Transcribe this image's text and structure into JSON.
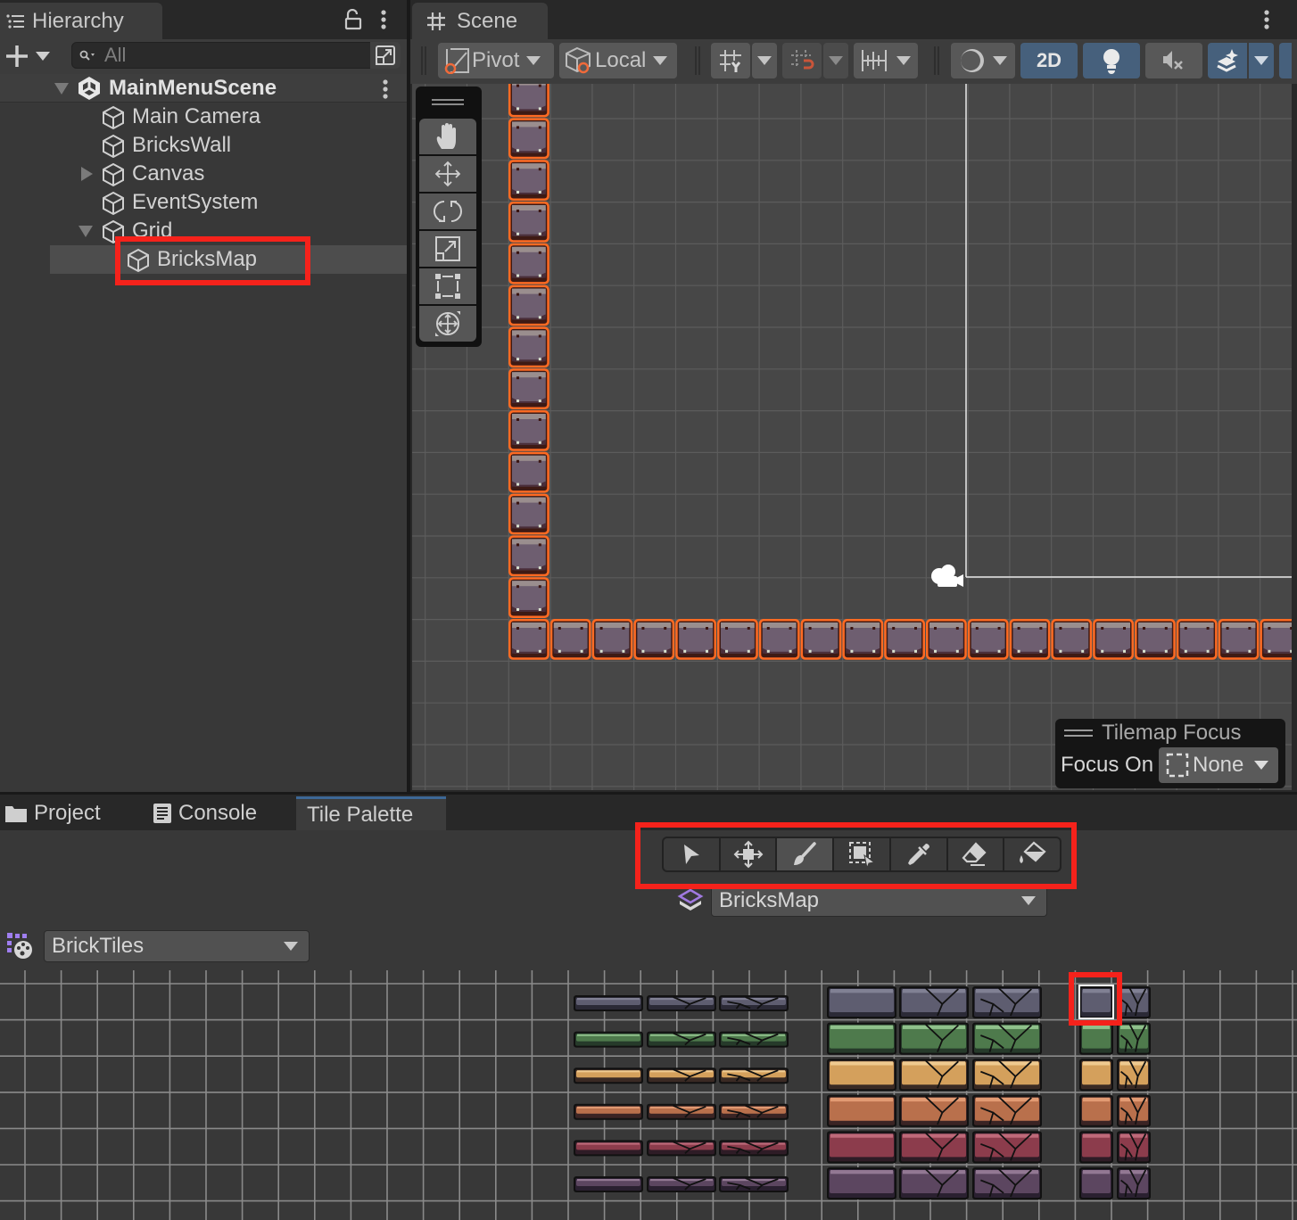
{
  "hierarchy": {
    "tab_label": "Hierarchy",
    "search_placeholder": "All",
    "scene": "MainMenuScene",
    "items": [
      {
        "label": "Main Camera",
        "depth": 1,
        "foldout": "none"
      },
      {
        "label": "BricksWall",
        "depth": 1,
        "foldout": "none"
      },
      {
        "label": "Canvas",
        "depth": 1,
        "foldout": "collapsed"
      },
      {
        "label": "EventSystem",
        "depth": 1,
        "foldout": "none"
      },
      {
        "label": "Grid",
        "depth": 1,
        "foldout": "expanded"
      },
      {
        "label": "BricksMap",
        "depth": 2,
        "foldout": "none",
        "selected": true
      }
    ]
  },
  "scene": {
    "tab_label": "Scene",
    "toolbar": {
      "pivot_label": "Pivot",
      "space_label": "Local",
      "mode_2d_label": "2D",
      "mode_2d_active": true,
      "lighting_active": true,
      "audio_active": false,
      "effects_active": true
    },
    "tools": [
      "hand",
      "move",
      "rotate",
      "scale",
      "rect",
      "transform"
    ],
    "tilemap_focus": {
      "title": "Tilemap Focus",
      "label": "Focus On",
      "value": "None"
    },
    "bricks": {
      "vertical_column_count": 13,
      "bottom_row_count": 19
    }
  },
  "bottom": {
    "tabs": [
      {
        "label": "Project",
        "icon": "folder-icon",
        "active": false
      },
      {
        "label": "Console",
        "icon": "console-icon",
        "active": false
      },
      {
        "label": "Tile Palette",
        "icon": "",
        "active": true
      }
    ],
    "palette_tools": [
      {
        "name": "select",
        "active": false
      },
      {
        "name": "move",
        "active": false
      },
      {
        "name": "paint",
        "active": true
      },
      {
        "name": "box-fill",
        "active": false
      },
      {
        "name": "picker",
        "active": false
      },
      {
        "name": "erase",
        "active": false
      },
      {
        "name": "flood-fill",
        "active": false
      }
    ],
    "active_tilemap": "BricksMap",
    "palette": "BrickTiles",
    "tile_colors": [
      {
        "name": "gray",
        "base": "#5e5d70",
        "light": "#8e8ea0",
        "dark": "#2b2a36"
      },
      {
        "name": "green",
        "base": "#4e7a4c",
        "light": "#a6d9a0",
        "dark": "#263a2a"
      },
      {
        "name": "yellow",
        "base": "#d4a05c",
        "light": "#f7d7a0",
        "dark": "#3a2a24"
      },
      {
        "name": "orange",
        "base": "#b9704c",
        "light": "#f0a880",
        "dark": "#3a2424"
      },
      {
        "name": "red",
        "base": "#8c3c4c",
        "light": "#d07a8a",
        "dark": "#2e1c26"
      },
      {
        "name": "purple",
        "base": "#5c4660",
        "light": "#a48aa4",
        "dark": "#2a2030"
      }
    ],
    "selected_tile": {
      "row": 0,
      "col": "small-intact"
    }
  },
  "annotations": {
    "highlight_color": "#f5221b"
  }
}
